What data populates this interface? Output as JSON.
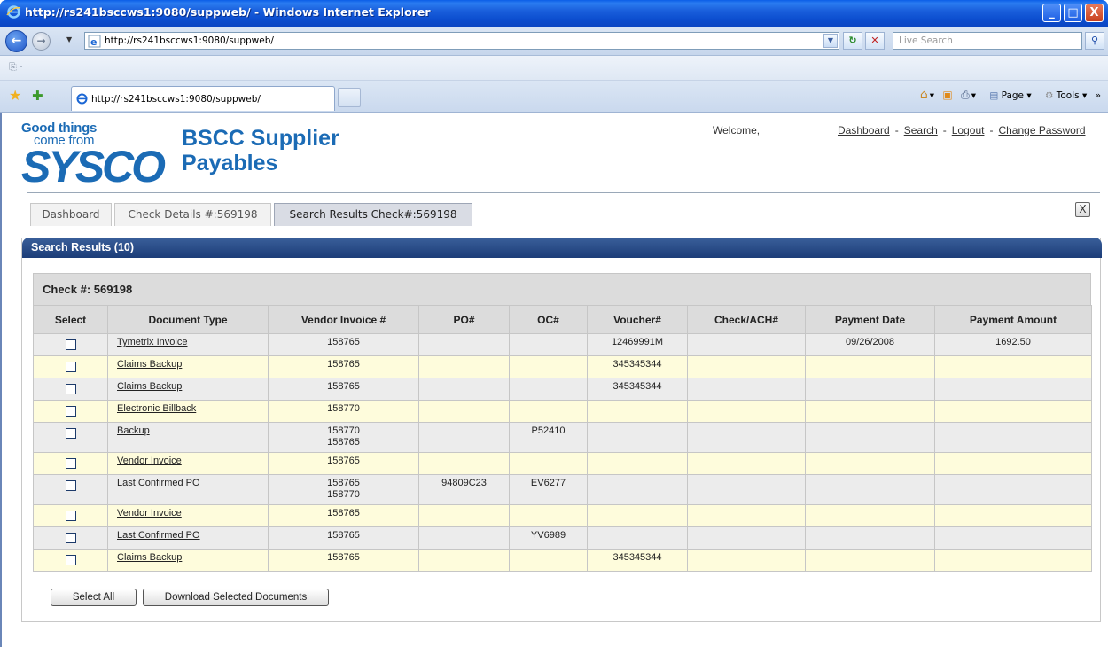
{
  "window": {
    "title": "http://rs241bsccws1:9080/suppweb/ - Windows Internet Explorer",
    "minimize_glyph": "_",
    "maximize_glyph": "□",
    "close_glyph": "X"
  },
  "addressbar": {
    "url": "http://rs241bsccws1:9080/suppweb/",
    "search_placeholder": "Live Search"
  },
  "browser_tab": {
    "label": "http://rs241bsccws1:9080/suppweb/"
  },
  "ie_toolbar": {
    "page_label": "Page",
    "tools_label": "Tools"
  },
  "header": {
    "logo_line1": "Good things",
    "logo_line2": "come from",
    "logo_brand": "SYSCO",
    "logo_tm": "™",
    "app_title_line1": "BSCC Supplier",
    "app_title_line2": "Payables",
    "welcome": "Welcome,",
    "links": [
      "Dashboard",
      "Search",
      "Logout",
      "Change Password"
    ],
    "link_separator": "-"
  },
  "tabs": [
    {
      "label": "Dashboard"
    },
    {
      "label": "Check Details #:569198"
    },
    {
      "label": "Search Results Check#:569198",
      "active": true
    }
  ],
  "tab_close": "X",
  "results": {
    "title": "Search Results (10)",
    "check_label": "Check #:  569198",
    "columns": [
      "Select",
      "Document Type",
      "Vendor Invoice #",
      "PO#",
      "OC#",
      "Voucher#",
      "Check/ACH#",
      "Payment Date",
      "Payment Amount"
    ],
    "rows": [
      {
        "doc": "Tymetrix Invoice",
        "inv": [
          "158765"
        ],
        "po": "",
        "oc": "",
        "voucher": "12469991M",
        "check": "",
        "date": "09/26/2008",
        "amount": "1692.50"
      },
      {
        "doc": "Claims Backup",
        "inv": [
          "158765"
        ],
        "po": "",
        "oc": "",
        "voucher": "345345344",
        "check": "",
        "date": "",
        "amount": ""
      },
      {
        "doc": "Claims Backup",
        "inv": [
          "158765"
        ],
        "po": "",
        "oc": "",
        "voucher": "345345344",
        "check": "",
        "date": "",
        "amount": ""
      },
      {
        "doc": "Electronic Billback",
        "inv": [
          "158770"
        ],
        "po": "",
        "oc": "",
        "voucher": "",
        "check": "",
        "date": "",
        "amount": ""
      },
      {
        "doc": "Backup",
        "inv": [
          "158770",
          "158765"
        ],
        "po": "",
        "oc": "P52410",
        "voucher": "",
        "check": "",
        "date": "",
        "amount": ""
      },
      {
        "doc": "Vendor Invoice",
        "inv": [
          "158765"
        ],
        "po": "",
        "oc": "",
        "voucher": "",
        "check": "",
        "date": "",
        "amount": ""
      },
      {
        "doc": "Last Confirmed PO",
        "inv": [
          "158765",
          "158770"
        ],
        "po": "94809C23",
        "oc": "EV6277",
        "voucher": "",
        "check": "",
        "date": "",
        "amount": ""
      },
      {
        "doc": "Vendor Invoice",
        "inv": [
          "158765"
        ],
        "po": "",
        "oc": "",
        "voucher": "",
        "check": "",
        "date": "",
        "amount": ""
      },
      {
        "doc": "Last Confirmed PO",
        "inv": [
          "158765"
        ],
        "po": "",
        "oc": "YV6989",
        "voucher": "",
        "check": "",
        "date": "",
        "amount": ""
      },
      {
        "doc": "Claims Backup",
        "inv": [
          "158765"
        ],
        "po": "",
        "oc": "",
        "voucher": "345345344",
        "check": "",
        "date": "",
        "amount": ""
      }
    ]
  },
  "buttons": {
    "select_all": "Select All",
    "download": "Download Selected Documents"
  },
  "colors": {
    "titlebar": "#0b46c2",
    "brand_blue": "#1b6bb5",
    "panel_header": "#1c3d78",
    "row_odd": "#ececec",
    "row_even": "#fefcdc"
  }
}
